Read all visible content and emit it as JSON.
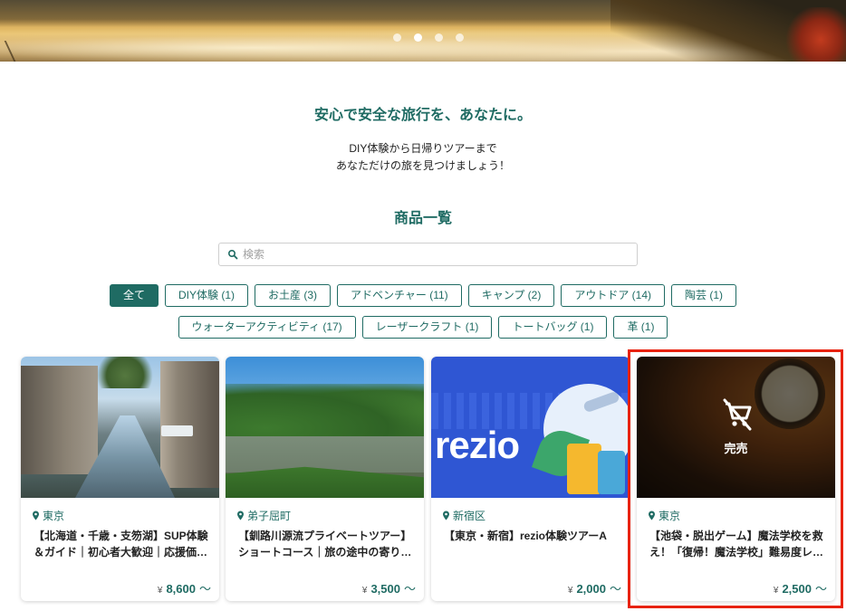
{
  "hero": {
    "carousel_dots": 4,
    "active_dot_index": 1
  },
  "tagline": "安心で安全な旅行を、あなたに。",
  "intro": [
    "DIY体験から日帰りツアーまで",
    "あなただけの旅を見つけましょう！"
  ],
  "section_title": "商品一覧",
  "search": {
    "placeholder": "検索",
    "icon": "search-icon"
  },
  "categories_row1": [
    {
      "label": "全て",
      "active": true
    },
    {
      "label": "DIY体験 (1)"
    },
    {
      "label": "お土産 (3)"
    },
    {
      "label": "アドベンチャー (11)"
    },
    {
      "label": "キャンプ (2)"
    },
    {
      "label": "アウトドア (14)"
    },
    {
      "label": "陶芸 (1)"
    }
  ],
  "categories_row2": [
    {
      "label": "ウォーターアクティビティ (17)"
    },
    {
      "label": "レーザークラフト (1)"
    },
    {
      "label": "トートバッグ (1)"
    },
    {
      "label": "革 (1)"
    }
  ],
  "products": [
    {
      "location": "東京",
      "title": "【北海道・千歳・支笏湖】SUP体験＆ガイド｜初心者大歓迎｜応援価…",
      "price_currency": "¥",
      "price": "8,600",
      "price_suffix": "〜"
    },
    {
      "location": "弟子屈町",
      "title": "【釧路川源流プライベートツアー】ショートコース｜旅の途中の寄り…",
      "price_currency": "¥",
      "price": "3,500",
      "price_suffix": "〜"
    },
    {
      "location": "新宿区",
      "title": "【東京・新宿】rezio体験ツアーA",
      "price_currency": "¥",
      "price": "2,000",
      "price_suffix": "〜",
      "image_logo": "rezio"
    },
    {
      "location": "東京",
      "title": "【池袋・脱出ゲーム】魔法学校を救え！「復帰！魔法学校」難易度レ…",
      "price_currency": "¥",
      "price": "2,500",
      "price_suffix": "〜",
      "sold_out_label": "完売",
      "highlighted": true
    }
  ],
  "colors": {
    "accent": "#1f6b63",
    "highlight": "#e8220f"
  }
}
